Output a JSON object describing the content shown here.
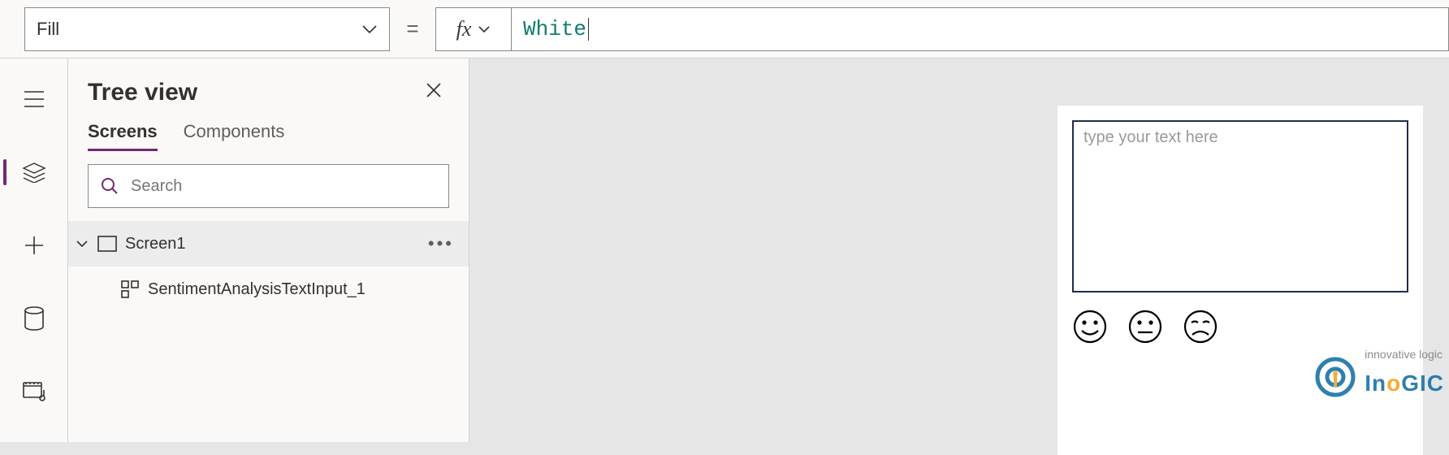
{
  "formula_bar": {
    "property": "Fill",
    "equals": "=",
    "fx_label": "fx",
    "formula": "White"
  },
  "tree_panel": {
    "title": "Tree view",
    "tabs": {
      "screens": "Screens",
      "components": "Components"
    },
    "search_placeholder": "Search",
    "items": [
      {
        "label": "Screen1",
        "selected": true,
        "has_children": true
      },
      {
        "label": "SentimentAnalysisTextInput_1"
      }
    ]
  },
  "canvas": {
    "text_input_placeholder": "type your text here"
  },
  "watermark": {
    "tagline": "innovative logic",
    "brand_pre": "In",
    "brand_o": "o",
    "brand_post": "GIC"
  }
}
